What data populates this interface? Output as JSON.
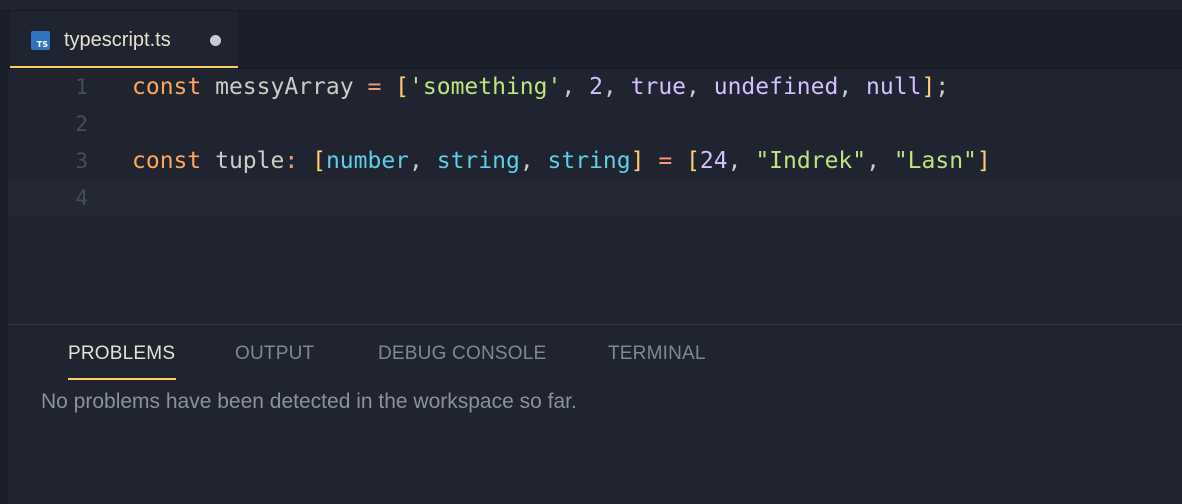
{
  "tab": {
    "filename": "typescript.ts",
    "icon": "typescript-file-icon",
    "icon_text": "TS",
    "unsaved": true
  },
  "editor": {
    "lines": [
      {
        "number": "1",
        "tokens": [
          {
            "t": "const",
            "c": "kw"
          },
          {
            "t": " ",
            "c": "pun"
          },
          {
            "t": "messyArray",
            "c": "id"
          },
          {
            "t": " ",
            "c": "pun"
          },
          {
            "t": "=",
            "c": "op"
          },
          {
            "t": " ",
            "c": "pun"
          },
          {
            "t": "[",
            "c": "br"
          },
          {
            "t": "'something'",
            "c": "str"
          },
          {
            "t": ", ",
            "c": "pun"
          },
          {
            "t": "2",
            "c": "num"
          },
          {
            "t": ", ",
            "c": "pun"
          },
          {
            "t": "true",
            "c": "lit"
          },
          {
            "t": ", ",
            "c": "pun"
          },
          {
            "t": "undefined",
            "c": "lit"
          },
          {
            "t": ", ",
            "c": "pun"
          },
          {
            "t": "null",
            "c": "lit"
          },
          {
            "t": "]",
            "c": "br"
          },
          {
            "t": ";",
            "c": "pun"
          }
        ]
      },
      {
        "number": "2",
        "tokens": []
      },
      {
        "number": "3",
        "tokens": [
          {
            "t": "const",
            "c": "kw"
          },
          {
            "t": " ",
            "c": "pun"
          },
          {
            "t": "tuple",
            "c": "id"
          },
          {
            "t": ":",
            "c": "op"
          },
          {
            "t": " ",
            "c": "pun"
          },
          {
            "t": "[",
            "c": "br"
          },
          {
            "t": "number",
            "c": "typ"
          },
          {
            "t": ", ",
            "c": "pun"
          },
          {
            "t": "string",
            "c": "typ"
          },
          {
            "t": ", ",
            "c": "pun"
          },
          {
            "t": "string",
            "c": "typ"
          },
          {
            "t": "]",
            "c": "br"
          },
          {
            "t": " ",
            "c": "pun"
          },
          {
            "t": "=",
            "c": "op"
          },
          {
            "t": " ",
            "c": "pun"
          },
          {
            "t": "[",
            "c": "br"
          },
          {
            "t": "24",
            "c": "num"
          },
          {
            "t": ", ",
            "c": "pun"
          },
          {
            "t": "\"Indrek\"",
            "c": "str"
          },
          {
            "t": ", ",
            "c": "pun"
          },
          {
            "t": "\"Lasn\"",
            "c": "str"
          },
          {
            "t": "]",
            "c": "br"
          }
        ]
      },
      {
        "number": "4",
        "tokens": [],
        "current": true
      }
    ]
  },
  "panel": {
    "tabs": [
      {
        "label": "PROBLEMS",
        "active": true
      },
      {
        "label": "OUTPUT",
        "active": false
      },
      {
        "label": "DEBUG CONSOLE",
        "active": false
      },
      {
        "label": "TERMINAL",
        "active": false
      }
    ],
    "message": "No problems have been detected in the workspace so far."
  },
  "colors": {
    "accent": "#ffcc66",
    "background": "#1f2430",
    "keyword": "#ffa759",
    "string": "#bae67e",
    "type": "#5ccfe6",
    "constant": "#d4bfff",
    "operator": "#f29e74",
    "bracket": "#ffd173"
  }
}
